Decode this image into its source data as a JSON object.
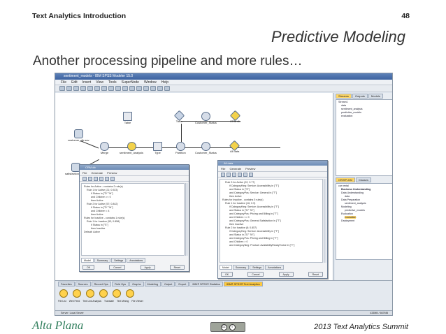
{
  "slide": {
    "header_left": "Text Analytics Introduction",
    "page_number": "48",
    "title": "Predictive Modeling",
    "subtitle": "Another processing pipeline and more rules…",
    "footer_left": "Alta Plana",
    "footer_right": "2013 Text Analytics Summit",
    "license_badge": "cc by",
    "accent_color": "#2f7d5b"
  },
  "app": {
    "window_title": "sentiment_models - IBM SPSS Modeler 15.0",
    "menu": [
      "File",
      "Edit",
      "Insert",
      "View",
      "Tools",
      "SuperNode",
      "Window",
      "Help"
    ],
    "nodes": [
      {
        "label": "customer_db.sav"
      },
      {
        "label": "Table"
      },
      {
        "label": "Table"
      },
      {
        "label": "Customer_Status"
      },
      {
        "label": "CRM db"
      },
      {
        "label": "Merge"
      },
      {
        "label": "sentiment_analysis"
      },
      {
        "label": "Type"
      },
      {
        "label": "Partition"
      },
      {
        "label": "Customer_Status"
      },
      {
        "label": "All data"
      },
      {
        "label": "satisfaction_rules"
      }
    ],
    "win1": {
      "title": "CRM db",
      "toolbar": [
        "File",
        "Generate",
        "Preview"
      ],
      "lines": [
        "Rules for Active - contains 2 rule(s)",
        "Rule 1 for Active (21; 0.923)",
        "if Status in [\"D\" \"M\"]",
        "and Children >= 0",
        "then Active",
        "Rule 2 for Active (57; 0.842)",
        "if Status in [\"D\" \"M\"]",
        "and Children < 4",
        "then Active",
        "Rules for Inactive - contains 1 rule(s)",
        "Rule 1 for Inactive (53; 0.858)",
        "if Status in [\"S\"]",
        "then Inactive",
        "Default: Active"
      ],
      "tabs": [
        "Model",
        "Summary",
        "Settings",
        "Annotations"
      ],
      "buttons": [
        "OK",
        "Cancel",
        "Apply",
        "Reset"
      ]
    },
    "win2": {
      "title": "All data",
      "toolbar": [
        "File",
        "Generate",
        "Preview"
      ],
      "lines": [
        "Rule 3 for Active (22; 0.77)",
        "if CategoryNeg: Service: Accessibility in [\"T\"]",
        "and Status in [\"S\"]",
        "and CategoryPos: Service: General in [\"T\"]",
        "then Active",
        "Rules for Inactive - contains 5 rule(s)",
        "Rule 1 for Inactive (16; 0.9)",
        "if CategoryNeg: Service: Accessibility in [\"T\"]",
        "and Status in [\"D\" \"M\"]",
        "and CategoryPos: Pricing and Billing in [\"T\"]",
        "and Children <= 0",
        "and CategoryPos: General Satisfaction in [\"T\"]",
        "then Inactive",
        "Rule 2 for Inactive (8; 0.857)",
        "if CategoryNeg: Service: Accessibility in [\"T\"]",
        "and Status in [\"D\" \"M\"]",
        "and CategoryPos: Pricing and Billing in [\"T\"]",
        "and Children > 0",
        "and CategoryNeg: Product: AvailabilityReadyToUse in [\"T\"]"
      ],
      "tabs": [
        "Model",
        "Summary",
        "Settings",
        "Annotations"
      ],
      "buttons": [
        "OK",
        "Cancel",
        "Apply",
        "Reset"
      ]
    },
    "right_panel": {
      "tabs": [
        "Streams",
        "Outputs",
        "Models"
      ],
      "streams": [
        "Stream1",
        "data",
        "sentiment_analysis",
        "predictive_models",
        "evaluation"
      ],
      "tabs2": [
        "CRISP-DM",
        "Classes"
      ],
      "crisp": [
        "car rental",
        "Business Understanding",
        "Data Understanding",
        "data",
        "Data Preparation",
        "sentiment_analysis",
        "Modeling",
        "predictive_models",
        "Evaluation",
        "evaluation",
        "Deployment"
      ]
    },
    "palette_tabs": [
      "Favorites",
      "Sources",
      "Record Ops",
      "Field Ops",
      "Graphs",
      "Modeling",
      "Output",
      "Export",
      "IBM® SPSS® Statistics",
      "IBM® SPSS® Text Analytics"
    ],
    "palette_labels": [
      "File List",
      "Web Feed",
      "Text Link Analysis",
      "Translate",
      "Text Mining",
      "File Viewer"
    ],
    "status_left": "Server: Local Server",
    "status_right": "433MB / 667MB"
  }
}
